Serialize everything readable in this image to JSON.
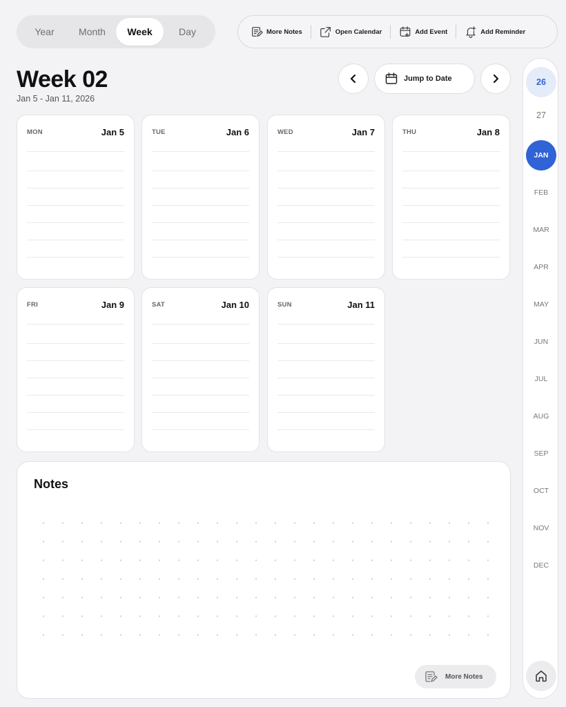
{
  "view_switcher": {
    "options": [
      "Year",
      "Month",
      "Week",
      "Day"
    ],
    "selected": "Week"
  },
  "toolbar": {
    "more_notes": "More Notes",
    "open_calendar": "Open Calendar",
    "add_event": "Add Event",
    "add_reminder": "Add Reminder"
  },
  "header": {
    "title": "Week 02",
    "range": "Jan 5 - Jan 11, 2026",
    "jump_label": "Jump to Date"
  },
  "days": [
    {
      "name": "MON",
      "date": "Jan 5"
    },
    {
      "name": "TUE",
      "date": "Jan 6"
    },
    {
      "name": "WED",
      "date": "Jan 7"
    },
    {
      "name": "THU",
      "date": "Jan 8"
    },
    {
      "name": "FRI",
      "date": "Jan 9"
    },
    {
      "name": "SAT",
      "date": "Jan 10"
    },
    {
      "name": "SUN",
      "date": "Jan 11"
    }
  ],
  "notes": {
    "title": "Notes",
    "more_label": "More Notes"
  },
  "rail": {
    "years": [
      "26",
      "27"
    ],
    "months": [
      "JAN",
      "FEB",
      "MAR",
      "APR",
      "MAY",
      "JUN",
      "JUL",
      "AUG",
      "SEP",
      "OCT",
      "NOV",
      "DEC"
    ],
    "selected_year": "26",
    "selected_month": "JAN"
  },
  "colors": {
    "accent": "#2f63d6",
    "accent_light": "#e4ebf9",
    "background": "#f3f3f5"
  }
}
